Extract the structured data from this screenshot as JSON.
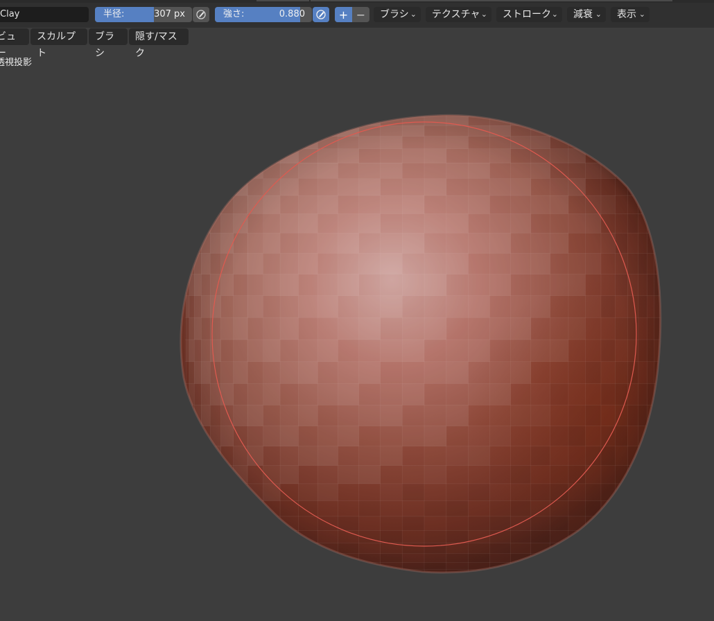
{
  "toolbar": {
    "brush_name": "Clay",
    "radius": {
      "label": "半径:",
      "value": "307 px",
      "fill_fraction": 0.61
    },
    "strength": {
      "label": "強さ:",
      "value": "0.880",
      "fill_fraction": 0.88
    },
    "plus": "+",
    "minus": "−",
    "menus": [
      {
        "label": "ブラシ"
      },
      {
        "label": "テクスチャ"
      },
      {
        "label": "ストローク"
      },
      {
        "label": "減衰"
      },
      {
        "label": "表示"
      }
    ],
    "chevron": "⌄"
  },
  "menubar": {
    "items": [
      {
        "label": "ビュー"
      },
      {
        "label": "スカルプト"
      },
      {
        "label": "ブラシ"
      },
      {
        "label": "隠す/マスク"
      }
    ]
  },
  "viewport": {
    "projection_label": "透視投影",
    "mesh_color": "#9a4736",
    "brush_circle_color": "#e05a50",
    "background": "#3d3d3d"
  }
}
